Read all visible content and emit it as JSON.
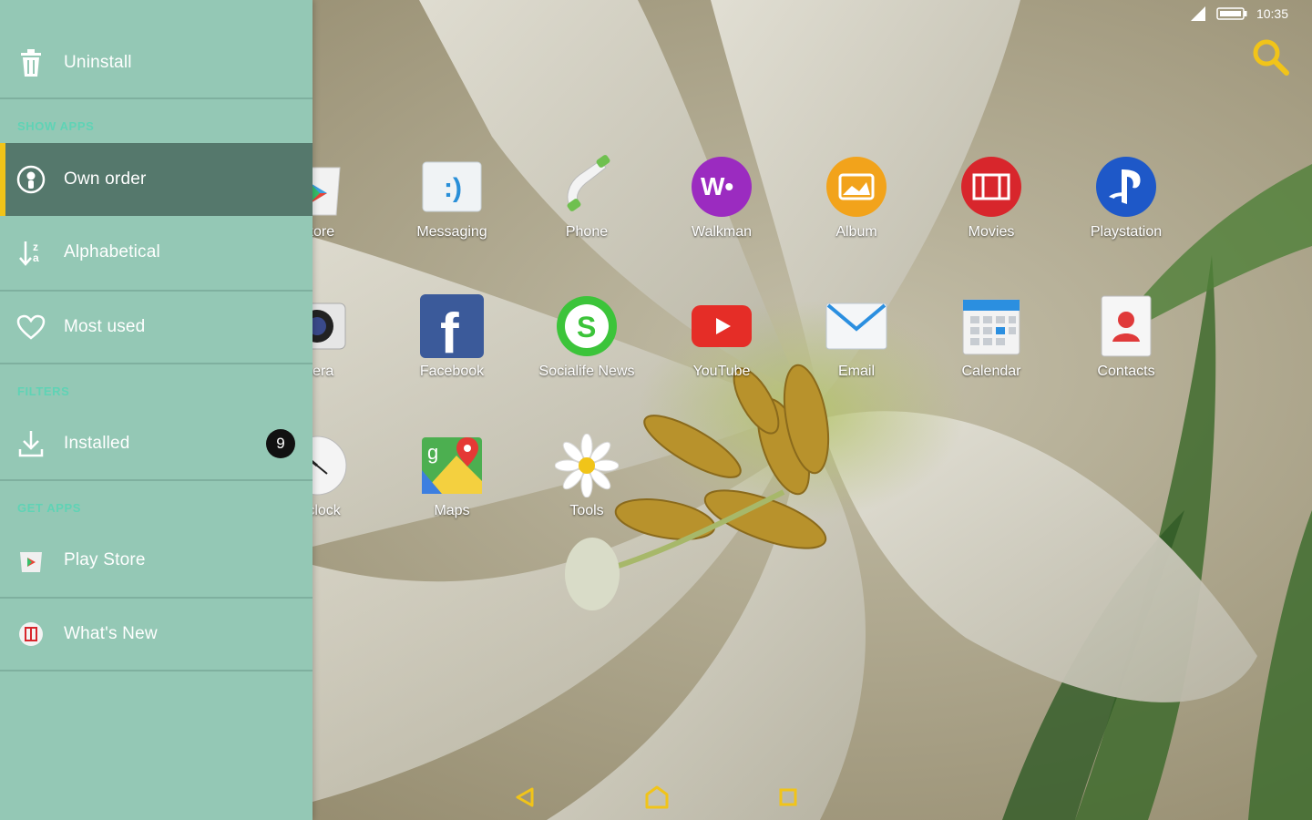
{
  "status_bar": {
    "time": "10:35"
  },
  "drawer": {
    "uninstall_label": "Uninstall",
    "sections": {
      "show_apps": "SHOW APPS",
      "filters": "FILTERS",
      "get_apps": "GET APPS"
    },
    "items": {
      "own_order": "Own order",
      "alphabetical": "Alphabetical",
      "most_used": "Most used",
      "installed": "Installed",
      "installed_count": "9",
      "play_store": "Play Store",
      "whats_new": "What's New"
    },
    "selected": "Own order",
    "accent_color": "#f1c419",
    "background_color": "#94c8b5",
    "selected_color": "#55786c"
  },
  "apps": {
    "row1": [
      "Store",
      "Messaging",
      "Phone",
      "Walkman",
      "Album",
      "Movies",
      "Playstation"
    ],
    "row2": [
      "mera",
      "Facebook",
      "Socialife News",
      "YouTube",
      "Email",
      "Calendar",
      "Contacts"
    ],
    "row3": [
      "& clock",
      "Maps",
      "Tools"
    ]
  },
  "icons": {
    "search": "search-icon",
    "back": "back-icon",
    "home": "home-icon",
    "recents": "recents-icon"
  }
}
